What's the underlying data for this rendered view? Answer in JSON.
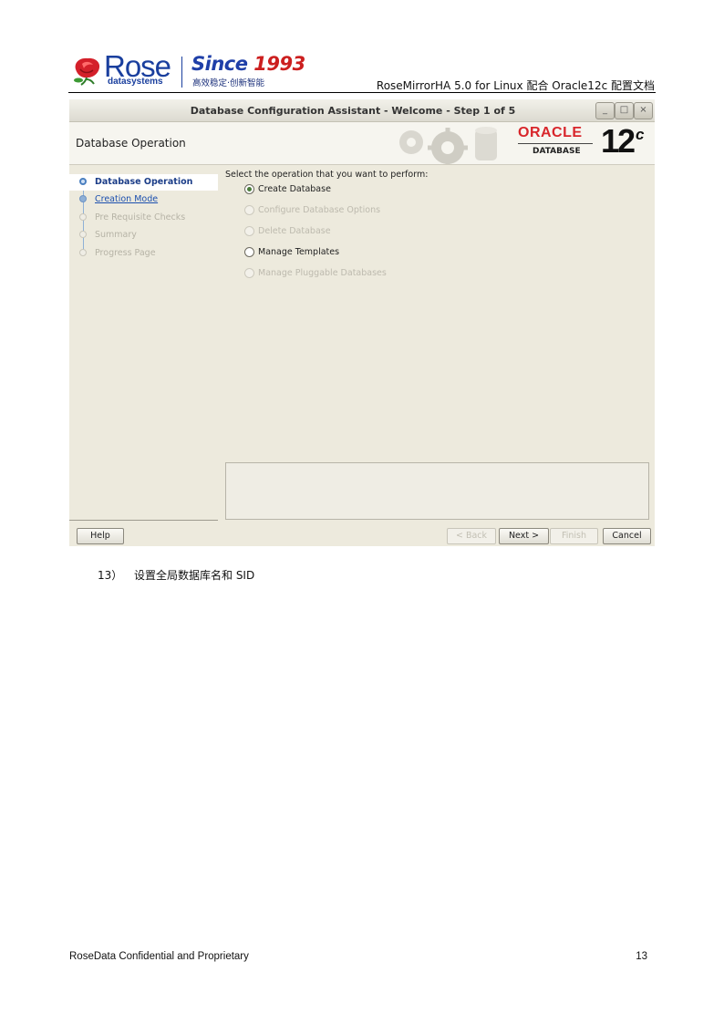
{
  "header": {
    "logo_name": "Rose",
    "logo_sub": "datasystems",
    "since_word": "Since",
    "since_year": "1993",
    "slogan": "高效稳定·创新智能",
    "doc_title": "RoseMirrorHA 5.0 for Linux  配合 Oracle12c 配置文档"
  },
  "window": {
    "title": "Database Configuration Assistant - Welcome - Step 1 of 5",
    "controls": {
      "minimize": "_",
      "maximize": "□",
      "close": "×"
    },
    "banner_title": "Database Operation",
    "brand": {
      "oracle": "ORACLE",
      "database": "DATABASE",
      "version": "12",
      "version_suffix": "c"
    }
  },
  "nav": {
    "items": [
      {
        "label": "Database Operation",
        "state": "active"
      },
      {
        "label": "Creation Mode",
        "state": "link"
      },
      {
        "label": "Pre Requisite Checks",
        "state": "disabled"
      },
      {
        "label": "Summary",
        "state": "disabled"
      },
      {
        "label": "Progress Page",
        "state": "disabled"
      }
    ]
  },
  "content": {
    "prompt": "Select the operation that you want to perform:",
    "options": [
      {
        "label": "Create Database",
        "selected": true,
        "enabled": true
      },
      {
        "label": "Configure Database Options",
        "selected": false,
        "enabled": false
      },
      {
        "label": "Delete Database",
        "selected": false,
        "enabled": false
      },
      {
        "label": "Manage Templates",
        "selected": false,
        "enabled": true
      },
      {
        "label": "Manage Pluggable Databases",
        "selected": false,
        "enabled": false
      }
    ]
  },
  "buttons": {
    "help": "Help",
    "back": "< Back",
    "next": "Next >",
    "finish": "Finish",
    "cancel": "Cancel"
  },
  "body": {
    "step_number": "13）",
    "step_text": "设置全局数据库名和 SID"
  },
  "footer": {
    "left": "RoseData Confidential and Proprietary",
    "page": "13"
  },
  "colors": {
    "brand_blue": "#1a3f9e",
    "brand_red": "#cc1f1f",
    "oracle_red": "#d8262b",
    "dialog_bg": "#edeadd"
  }
}
